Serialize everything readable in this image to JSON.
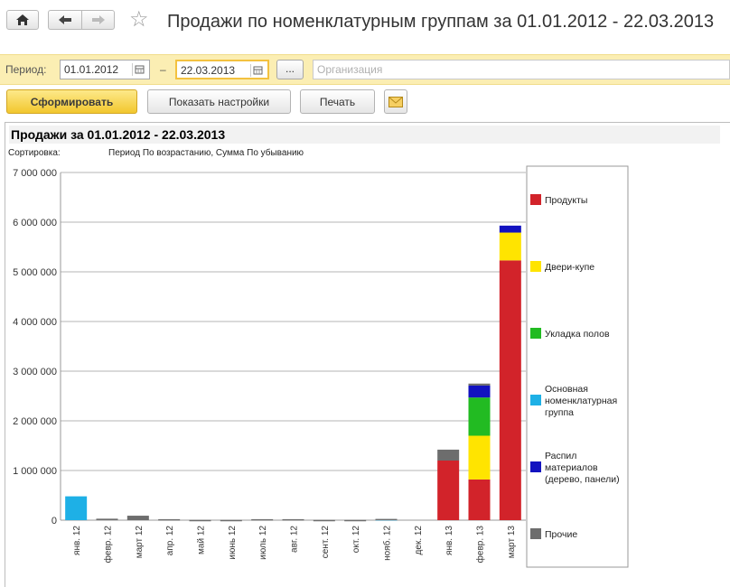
{
  "header": {
    "title": "Продажи по номенклатурным группам за 01.01.2012 - 22.03.2013"
  },
  "filter": {
    "period_label": "Период:",
    "date_from": "01.01.2012",
    "dash": "–",
    "date_to": "22.03.2013",
    "more_label": "...",
    "org_placeholder": "Организация"
  },
  "toolbar": {
    "generate_label": "Сформировать",
    "settings_label": "Показать настройки",
    "print_label": "Печать"
  },
  "report": {
    "title": "Продажи за 01.01.2012 - 22.03.2013",
    "sort_label": "Сортировка:",
    "sort_value": "Период По возрастанию, Сумма По убыванию"
  },
  "chart_data": {
    "type": "bar",
    "stacked": true,
    "categories": [
      "янв. 12",
      "февр. 12",
      "март 12",
      "апр. 12",
      "май 12",
      "июнь 12",
      "июль 12",
      "авг. 12",
      "сент. 12",
      "окт. 12",
      "нояб. 12",
      "дек. 12",
      "янв. 13",
      "февр. 13",
      "март 13"
    ],
    "ylim": [
      0,
      7000000
    ],
    "yticks": [
      "0",
      "1 000 000",
      "2 000 000",
      "3 000 000",
      "4 000 000",
      "5 000 000",
      "6 000 000",
      "7 000 000"
    ],
    "grid": true,
    "legend_position": "right",
    "series": [
      {
        "name": "Продукты",
        "color": "#d2232a",
        "values": [
          0,
          0,
          0,
          0,
          0,
          0,
          0,
          0,
          0,
          0,
          0,
          0,
          1200000,
          820000,
          5230000
        ]
      },
      {
        "name": "Двери-купе",
        "color": "#ffe400",
        "values": [
          0,
          0,
          0,
          0,
          0,
          0,
          0,
          0,
          0,
          0,
          0,
          0,
          0,
          880000,
          560000
        ]
      },
      {
        "name": "Укладка полов",
        "color": "#22bb22",
        "values": [
          0,
          0,
          0,
          0,
          0,
          0,
          0,
          0,
          0,
          0,
          0,
          0,
          0,
          770000,
          0
        ]
      },
      {
        "name": "Основная номенклатурная группа",
        "color": "#1eb0e6",
        "values": [
          480000,
          0,
          0,
          0,
          0,
          0,
          0,
          0,
          0,
          0,
          20000,
          0,
          0,
          0,
          0
        ]
      },
      {
        "name": "Распил материалов (дерево, панели)",
        "color": "#1212c0",
        "values": [
          0,
          0,
          0,
          0,
          0,
          0,
          0,
          0,
          0,
          0,
          0,
          0,
          0,
          240000,
          140000
        ]
      },
      {
        "name": "Прочие",
        "color": "#6d6d6d",
        "values": [
          0,
          30000,
          90000,
          20000,
          5000,
          5000,
          20000,
          20000,
          5000,
          5000,
          5000,
          0,
          220000,
          40000,
          0
        ]
      }
    ]
  }
}
